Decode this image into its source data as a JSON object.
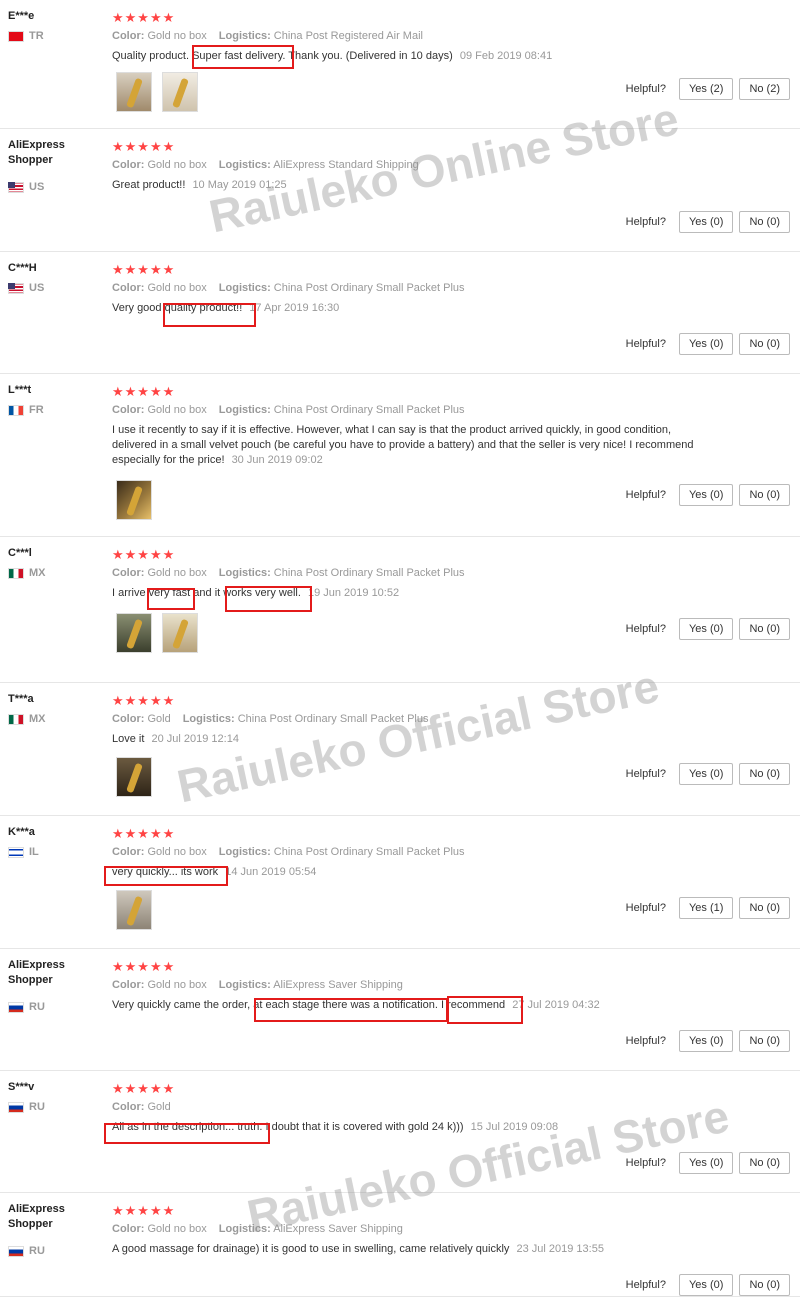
{
  "labels": {
    "color": "Color:",
    "logistics": "Logistics:",
    "helpful": "Helpful?"
  },
  "stars": "★★★★★",
  "watermarks": [
    "Raiuleko Online Store",
    "Raiuleko Official Store",
    "Raiuleko Official Store"
  ],
  "reviews": [
    {
      "user": "E***e",
      "country": "TR",
      "flag": "tr",
      "color": "Gold no box",
      "logistics": "China Post Registered Air Mail",
      "text": "Quality product. Super fast delivery. Thank you. (Delivered in 10 days)",
      "date": "09 Feb 2019 08:41",
      "yes": "Yes (2)",
      "no": "No (2)",
      "photos": 2
    },
    {
      "user": "AliExpress Shopper",
      "country": "US",
      "flag": "us",
      "color": "Gold no box",
      "logistics": "AliExpress Standard Shipping",
      "text": "Great product!!",
      "date": "10 May 2019 01:25",
      "yes": "Yes (0)",
      "no": "No (0)",
      "photos": 0
    },
    {
      "user": "C***H",
      "country": "US",
      "flag": "us",
      "color": "Gold no box",
      "logistics": "China Post Ordinary Small Packet Plus",
      "text": "Very good quality product!!",
      "date": "17 Apr 2019 16:30",
      "yes": "Yes (0)",
      "no": "No (0)",
      "photos": 0
    },
    {
      "user": "L***t",
      "country": "FR",
      "flag": "fr",
      "color": "Gold no box",
      "logistics": "China Post Ordinary Small Packet Plus",
      "text": "I use it recently to say if it is effective. However, what I can say is that the product arrived quickly, in good condition, delivered in a small velvet pouch (be careful you have to provide a battery) and that the seller is very nice! I recommend especially for the price!",
      "date": "30 Jun 2019 09:02",
      "yes": "Yes (0)",
      "no": "No (0)",
      "photos": 1
    },
    {
      "user": "C***l",
      "country": "MX",
      "flag": "mx",
      "color": "Gold no box",
      "logistics": "China Post Ordinary Small Packet Plus",
      "text": "I arrive very fast and it works very well.",
      "date": "19 Jun 2019 10:52",
      "yes": "Yes (0)",
      "no": "No (0)",
      "photos": 2
    },
    {
      "user": "T***a",
      "country": "MX",
      "flag": "mx",
      "color": "Gold",
      "logistics": "China Post Ordinary Small Packet Plus",
      "text": "Love it",
      "date": "20 Jul 2019 12:14",
      "yes": "Yes (0)",
      "no": "No (0)",
      "photos": 1
    },
    {
      "user": "K***a",
      "country": "IL",
      "flag": "il",
      "color": "Gold no box",
      "logistics": "China Post Ordinary Small Packet Plus",
      "text": "very quickly... its work",
      "date": "14 Jun 2019 05:54",
      "yes": "Yes (1)",
      "no": "No (0)",
      "photos": 1
    },
    {
      "user": "AliExpress Shopper",
      "country": "RU",
      "flag": "ru",
      "color": "Gold no box",
      "logistics": "AliExpress Saver Shipping",
      "text": "Very quickly came the order, at each stage there was a notification. I recommend",
      "date": "27 Jul 2019 04:32",
      "yes": "Yes (0)",
      "no": "No (0)",
      "photos": 0
    },
    {
      "user": "S***v",
      "country": "RU",
      "flag": "ru",
      "color": "Gold",
      "logistics": "",
      "text": "All as in the description... truth. I doubt that it is covered with gold 24 k)))",
      "date": "15 Jul 2019 09:08",
      "yes": "Yes (0)",
      "no": "No (0)",
      "photos": 0
    },
    {
      "user": "AliExpress Shopper",
      "country": "RU",
      "flag": "ru",
      "color": "Gold no box",
      "logistics": "AliExpress Saver Shipping",
      "text": "A good massage for drainage) it is good to use in swelling, came relatively quickly",
      "date": "23 Jul 2019 13:55",
      "yes": "Yes (0)",
      "no": "No (0)",
      "photos": 0
    }
  ]
}
